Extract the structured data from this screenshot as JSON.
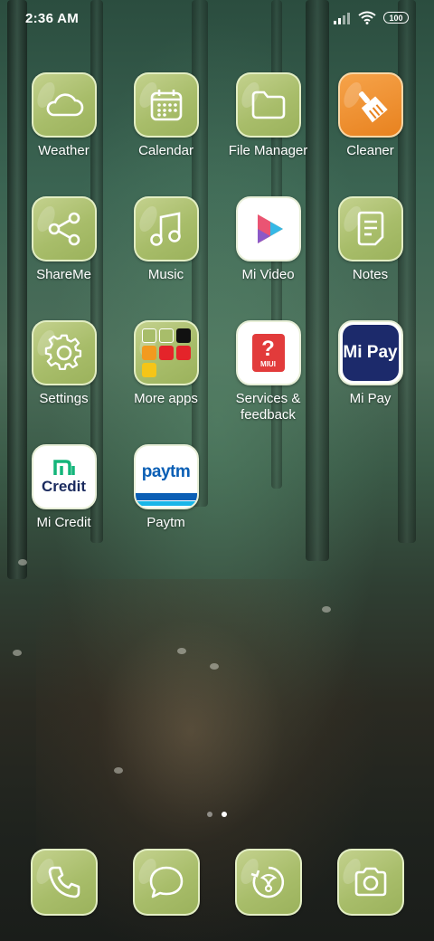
{
  "status_bar": {
    "time": "2:36 AM",
    "battery": "100",
    "icons": [
      "signal-icon",
      "wifi-icon",
      "battery-icon"
    ]
  },
  "apps": [
    {
      "label": "Weather",
      "icon": "cloud-icon"
    },
    {
      "label": "Calendar",
      "icon": "calendar-icon"
    },
    {
      "label": "File Manager",
      "icon": "folder-icon"
    },
    {
      "label": "Cleaner",
      "icon": "broom-icon"
    },
    {
      "label": "ShareMe",
      "icon": "share-icon"
    },
    {
      "label": "Music",
      "icon": "music-note-icon"
    },
    {
      "label": "Mi Video",
      "icon": "play-icon"
    },
    {
      "label": "Notes",
      "icon": "note-icon"
    },
    {
      "label": "Settings",
      "icon": "gear-icon"
    },
    {
      "label": "More apps",
      "icon": "folder-grid-icon"
    },
    {
      "label": "Services & feedback",
      "icon": "help-icon",
      "brand_text": "MIUI",
      "glyph": "?"
    },
    {
      "label": "Mi Pay",
      "icon": "mipay-icon",
      "brand_text": "Mi Pay"
    },
    {
      "label": "Mi Credit",
      "icon": "micredit-icon",
      "brand_text": "Credit"
    },
    {
      "label": "Paytm",
      "icon": "paytm-icon",
      "brand_text": "paytm"
    }
  ],
  "dock": [
    {
      "icon": "phone-icon"
    },
    {
      "icon": "message-icon"
    },
    {
      "icon": "browser-icon"
    },
    {
      "icon": "camera-icon"
    }
  ],
  "pages": {
    "count": 2,
    "active": 2
  },
  "colors": {
    "icon_bg": "#a8bd6a",
    "icon_border": "#e6f0c8",
    "cleaner": "#e8821f",
    "mipay_bg": "#1c2a6b",
    "paytm_blue": "#0b5fb5",
    "paytm_cyan": "#19b6e8",
    "micredit_green": "#14b57a",
    "services_red": "#e23b3b"
  }
}
